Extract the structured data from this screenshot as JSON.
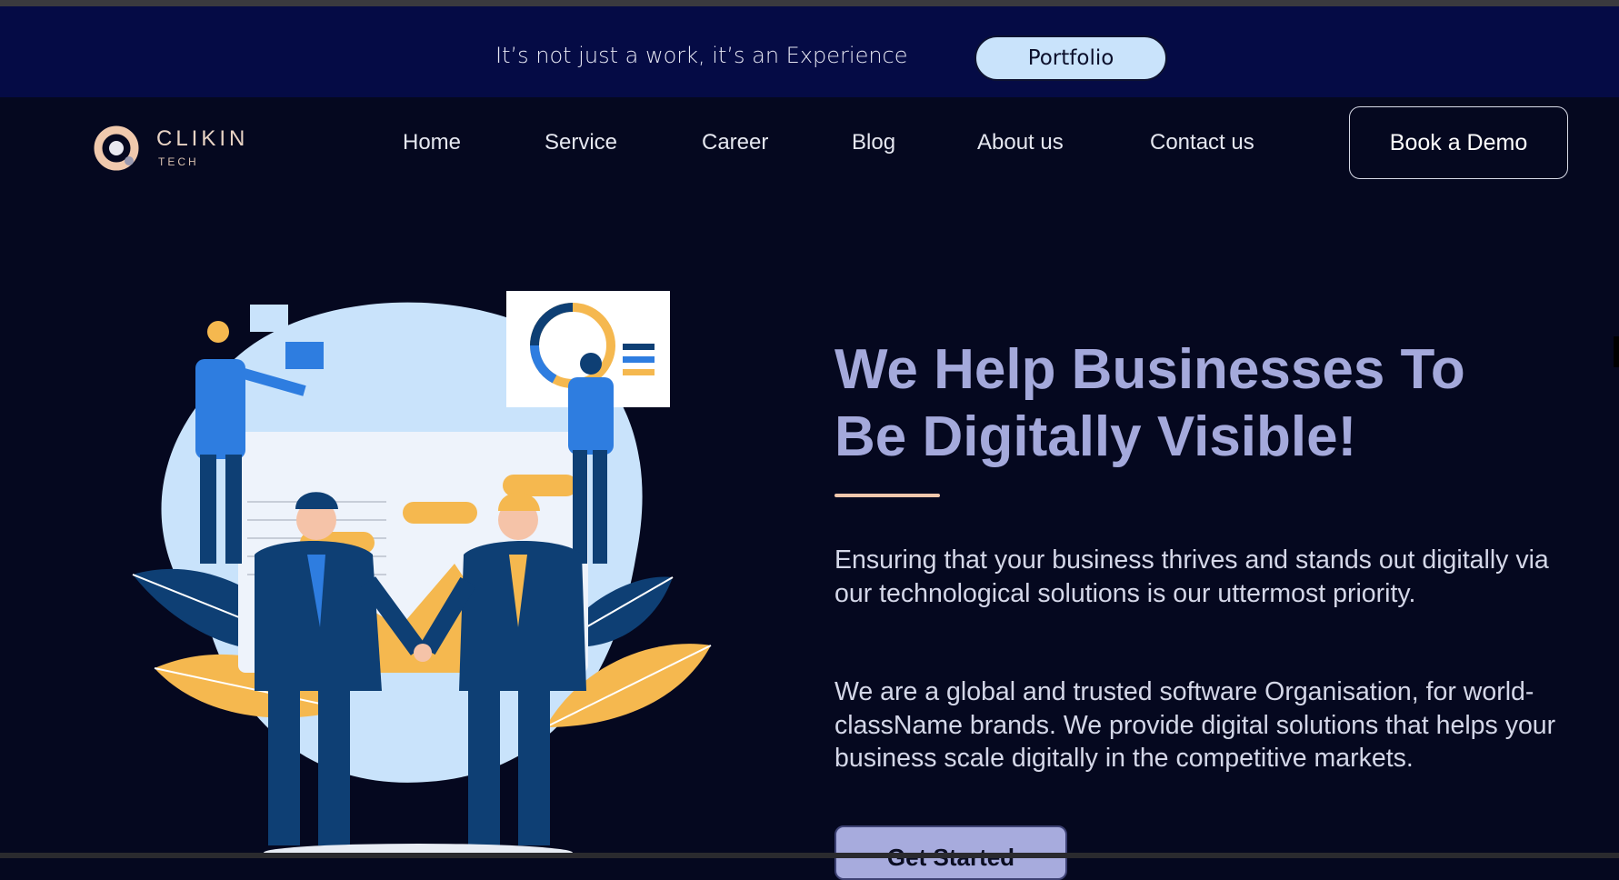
{
  "banner": {
    "text": "It’s not just a work, it’s an Experience",
    "button_label": "Portfolio"
  },
  "nav": {
    "logo_name": "CLIKIN",
    "logo_sub": "TECH",
    "links": [
      "Home",
      "Service",
      "Career",
      "Blog",
      "About us",
      "Contact us"
    ],
    "cta_label": "Book a Demo"
  },
  "hero": {
    "title_line1": "We Help Businesses To",
    "title_line2": "Be Digitally Visible!",
    "paragraph1": "Ensuring that your business thrives and stands out digitally via our technological solutions is our uttermost priority.",
    "paragraph2": "We are a global and trusted software Organisation, for world-className brands. We provide digital solutions that helps your business scale digitally in the competitive markets.",
    "button_label": "Get Started"
  },
  "colors": {
    "banner_bg": "#050b45",
    "page_bg": "#05081f",
    "title": "#a4a9db",
    "accent": "#f1c7ac",
    "portfolio_btn": "#c9e3fb"
  }
}
